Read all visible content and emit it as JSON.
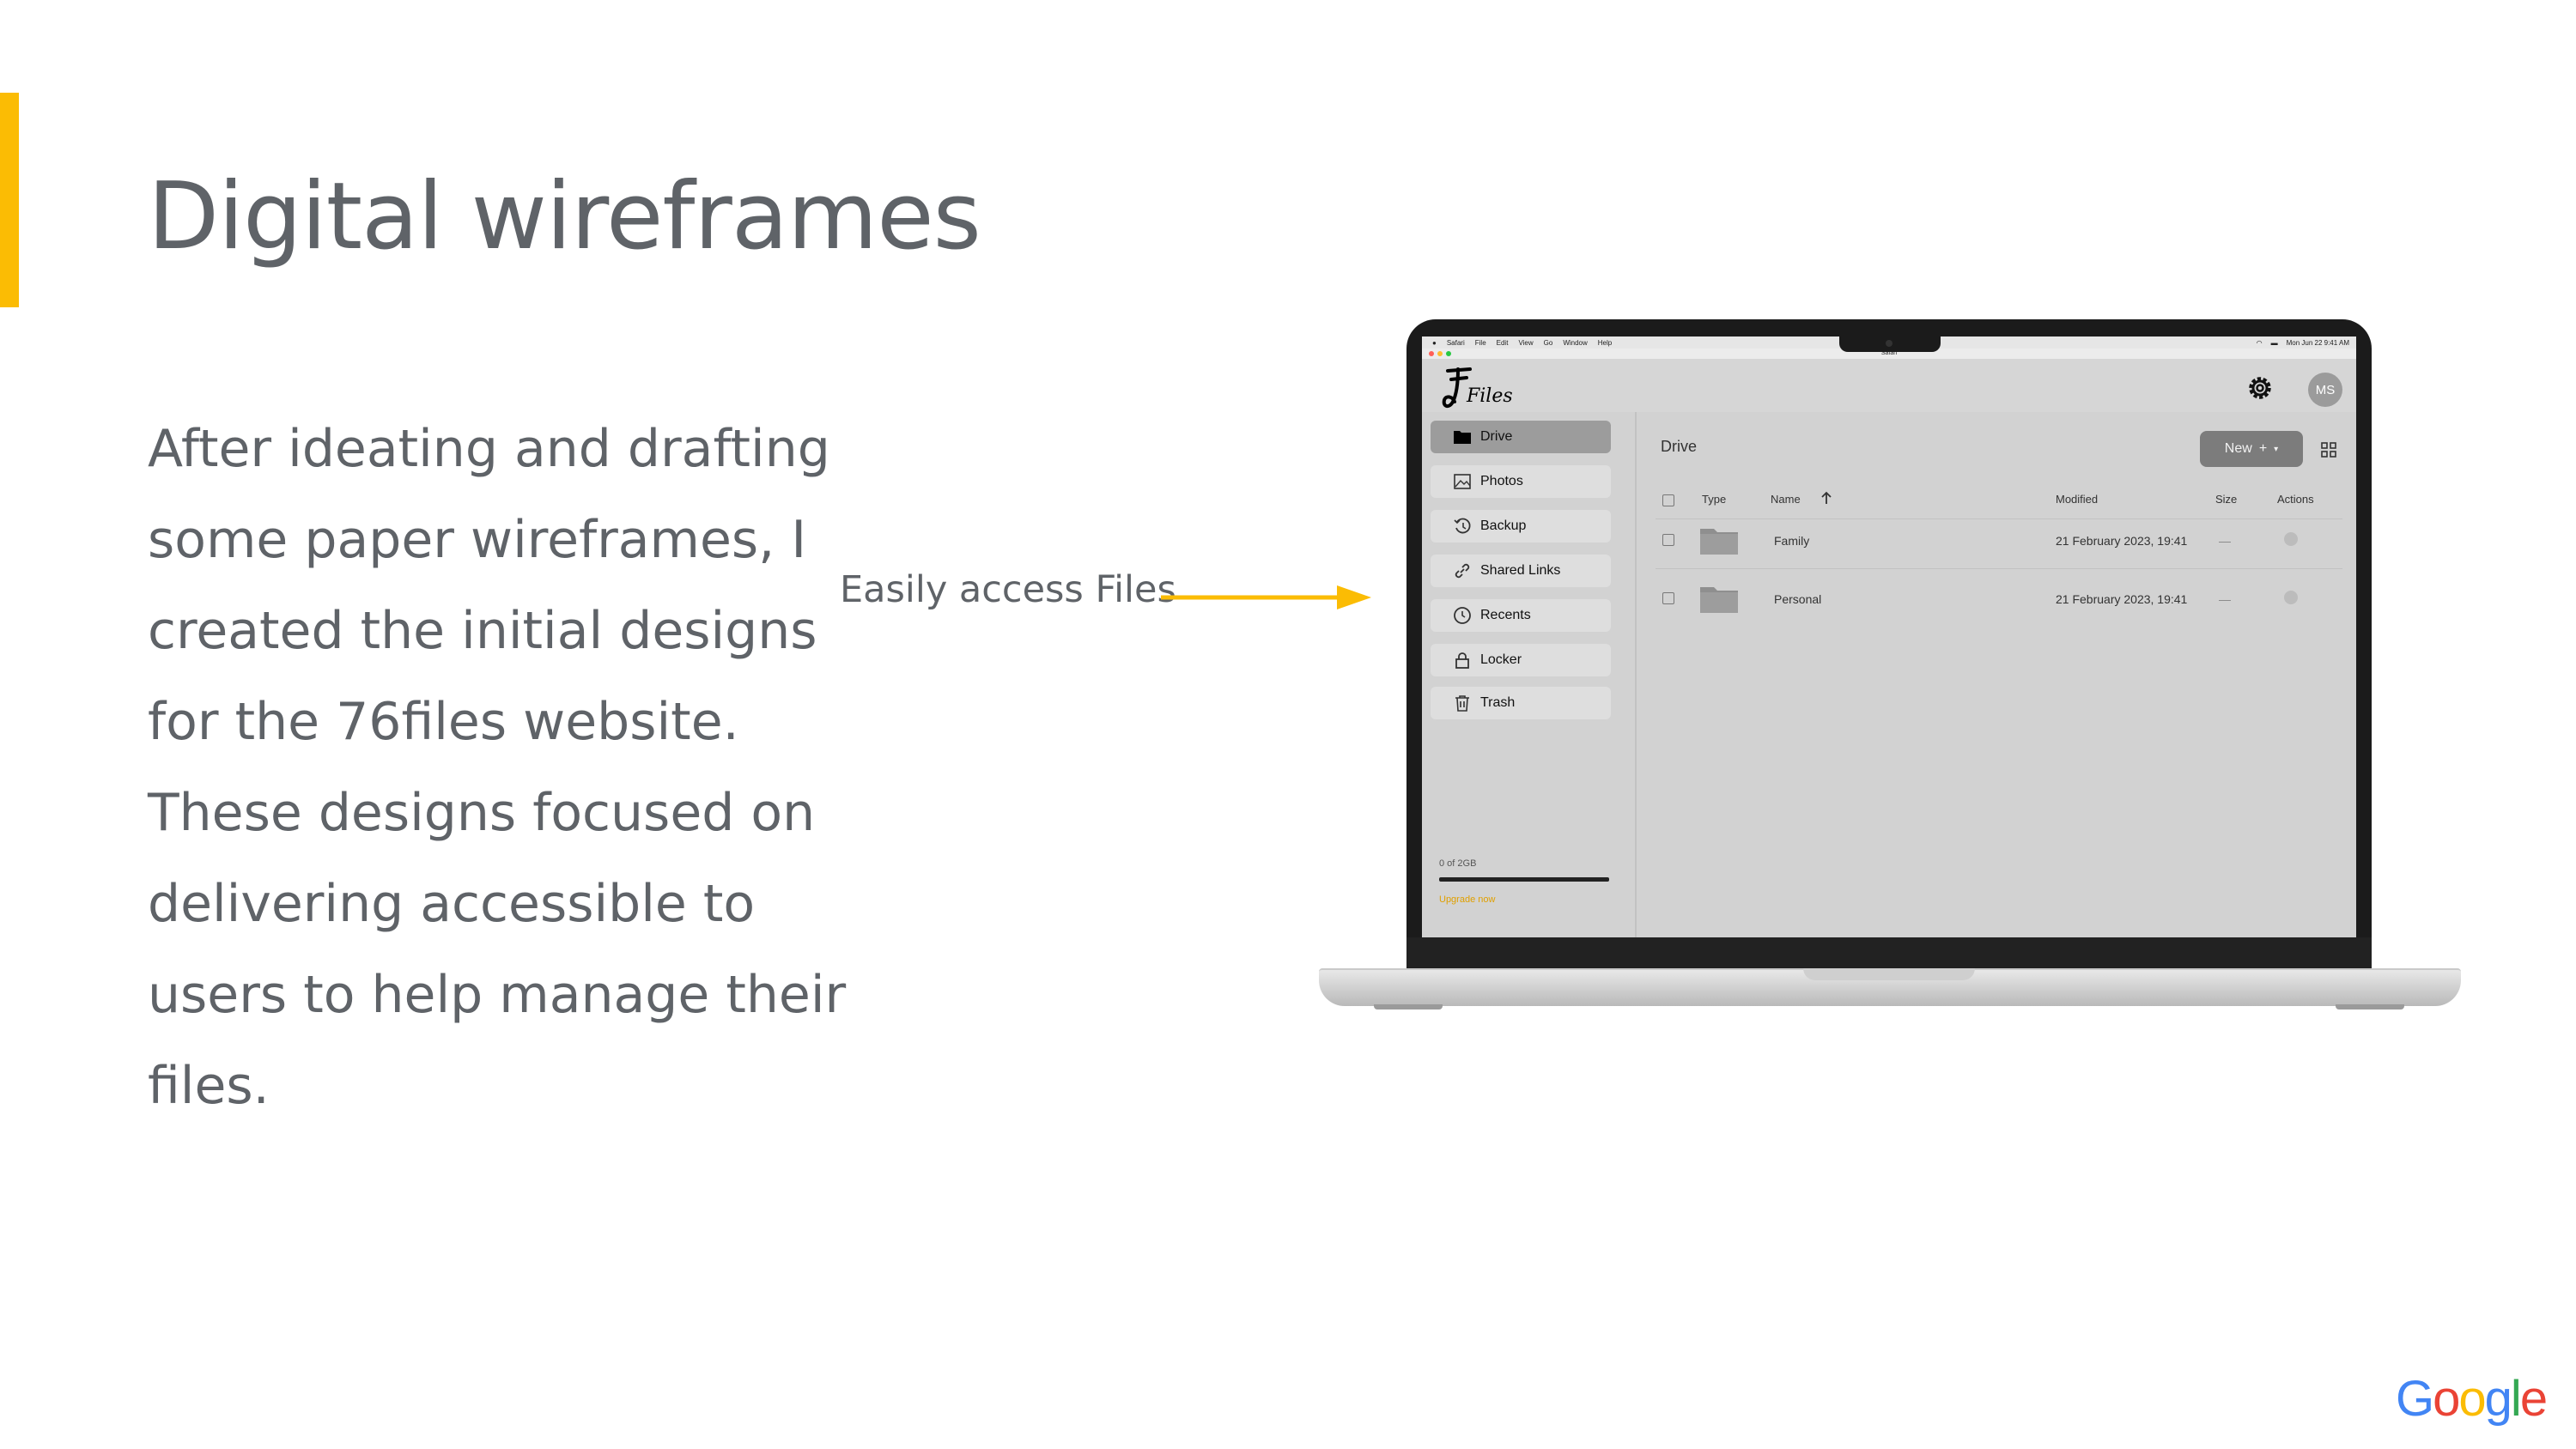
{
  "slide": {
    "title": "Digital wireframes",
    "body_lines": [
      "After ideating and drafting",
      "some paper wireframes, I",
      "created the initial designs",
      "for the 76files website.",
      "These designs focused on",
      "delivering accessible to",
      "users to help manage their",
      "files."
    ],
    "annotation": "Easily access Files",
    "accent_color": "#fbbc04",
    "brand": {
      "letters": [
        "G",
        "o",
        "o",
        "g",
        "l",
        "e"
      ]
    }
  },
  "mockup": {
    "mac_menubar": {
      "items": [
        "Safari",
        "File",
        "Edit",
        "View",
        "Go",
        "Window",
        "Help"
      ],
      "clock": "Mon Jun 22  9:41 AM"
    },
    "browser_tab_title": "Safari",
    "app": {
      "logo_text": "Files",
      "avatar_initials": "MS",
      "sidebar": [
        {
          "label": "Drive",
          "icon": "folder-icon",
          "active": true
        },
        {
          "label": "Photos",
          "icon": "image-icon"
        },
        {
          "label": "Backup",
          "icon": "history-icon"
        },
        {
          "label": "Shared Links",
          "icon": "link-icon"
        },
        {
          "label": "Recents",
          "icon": "clock-icon"
        },
        {
          "label": "Locker",
          "icon": "lock-icon"
        },
        {
          "label": "Trash",
          "icon": "trash-icon"
        }
      ],
      "storage": {
        "label": "0 of 2GB",
        "used_fraction": 0
      },
      "upgrade_label": "Upgrade now",
      "main_title": "Drive",
      "new_button": "New",
      "table": {
        "columns": [
          "Type",
          "Name",
          "Modified",
          "Size",
          "Actions"
        ],
        "rows": [
          {
            "name": "Family",
            "modified": "21 February 2023, 19:41",
            "size": "—"
          },
          {
            "name": "Personal",
            "modified": "21 February 2023, 19:41",
            "size": "—"
          }
        ]
      }
    }
  }
}
